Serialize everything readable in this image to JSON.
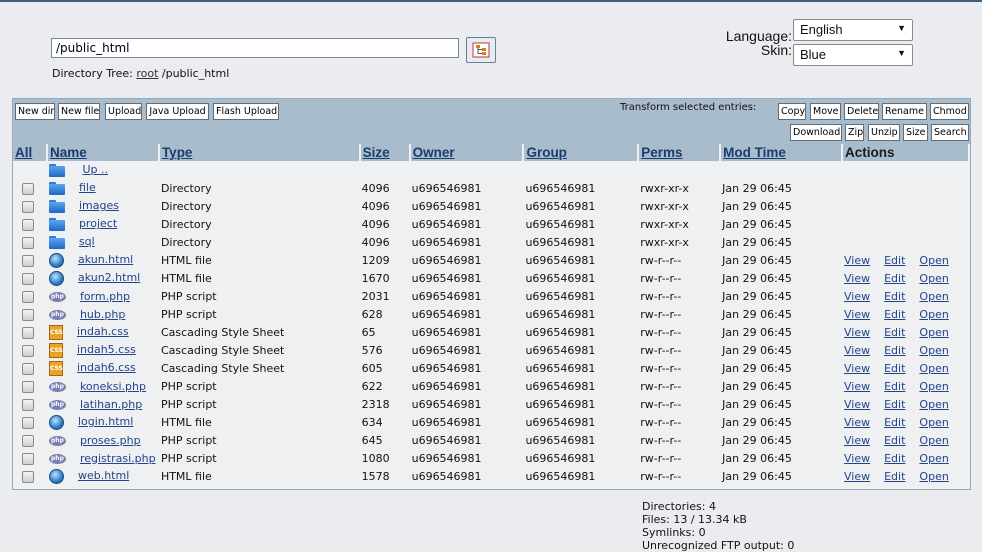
{
  "header": {
    "path_value": "/public_html",
    "directory_tree_label": "Directory Tree:",
    "directory_tree_root": "root",
    "directory_tree_path": "/public_html",
    "language_label": "Language:",
    "language_value": "English",
    "skin_label": "Skin:",
    "skin_value": "Blue"
  },
  "toolbar": {
    "buttons": [
      "New dir",
      "New file",
      "Upload",
      "Java Upload",
      "Flash Upload"
    ],
    "transform_label": "Transform selected entries:",
    "transform_row1": [
      "Copy",
      "Move",
      "Delete",
      "Rename",
      "Chmod"
    ],
    "transform_row2": [
      "Download",
      "Zip",
      "Unzip",
      "Size",
      "Search"
    ]
  },
  "table": {
    "headers": {
      "all": "All",
      "name": "Name",
      "type": "Type",
      "size": "Size",
      "owner": "Owner",
      "group": "Group",
      "perms": "Perms",
      "mod_time": "Mod Time",
      "actions": "Actions"
    },
    "up_label": "Up ..",
    "action_labels": {
      "view": "View",
      "edit": "Edit",
      "open": "Open"
    },
    "rows": [
      {
        "icon": "folder-icon",
        "name": "file",
        "type": "Directory",
        "size": "4096",
        "owner": "u696546981",
        "group": "u696546981",
        "perms": "rwxr-xr-x",
        "mod": "Jan 29 06:45"
      },
      {
        "icon": "folder-icon",
        "name": "images",
        "type": "Directory",
        "size": "4096",
        "owner": "u696546981",
        "group": "u696546981",
        "perms": "rwxr-xr-x",
        "mod": "Jan 29 06:45"
      },
      {
        "icon": "folder-icon",
        "name": "project",
        "type": "Directory",
        "size": "4096",
        "owner": "u696546981",
        "group": "u696546981",
        "perms": "rwxr-xr-x",
        "mod": "Jan 29 06:45"
      },
      {
        "icon": "folder-icon",
        "name": "sql",
        "type": "Directory",
        "size": "4096",
        "owner": "u696546981",
        "group": "u696546981",
        "perms": "rwxr-xr-x",
        "mod": "Jan 29 06:45"
      },
      {
        "icon": "html-file-icon",
        "name": "akun.html",
        "type": "HTML file",
        "size": "1209",
        "owner": "u696546981",
        "group": "u696546981",
        "perms": "rw-r--r--",
        "mod": "Jan 29 06:45"
      },
      {
        "icon": "html-file-icon",
        "name": "akun2.html",
        "type": "HTML file",
        "size": "1670",
        "owner": "u696546981",
        "group": "u696546981",
        "perms": "rw-r--r--",
        "mod": "Jan 29 06:45"
      },
      {
        "icon": "php-file-icon",
        "name": "form.php",
        "type": "PHP script",
        "size": "2031",
        "owner": "u696546981",
        "group": "u696546981",
        "perms": "rw-r--r--",
        "mod": "Jan 29 06:45"
      },
      {
        "icon": "php-file-icon",
        "name": "hub.php",
        "type": "PHP script",
        "size": "628",
        "owner": "u696546981",
        "group": "u696546981",
        "perms": "rw-r--r--",
        "mod": "Jan 29 06:45"
      },
      {
        "icon": "css-file-icon",
        "name": "indah.css",
        "type": "Cascading Style Sheet",
        "size": "65",
        "owner": "u696546981",
        "group": "u696546981",
        "perms": "rw-r--r--",
        "mod": "Jan 29 06:45"
      },
      {
        "icon": "css-file-icon",
        "name": "indah5.css",
        "type": "Cascading Style Sheet",
        "size": "576",
        "owner": "u696546981",
        "group": "u696546981",
        "perms": "rw-r--r--",
        "mod": "Jan 29 06:45"
      },
      {
        "icon": "css-file-icon",
        "name": "indah6.css",
        "type": "Cascading Style Sheet",
        "size": "605",
        "owner": "u696546981",
        "group": "u696546981",
        "perms": "rw-r--r--",
        "mod": "Jan 29 06:45"
      },
      {
        "icon": "php-file-icon",
        "name": "koneksi.php",
        "type": "PHP script",
        "size": "622",
        "owner": "u696546981",
        "group": "u696546981",
        "perms": "rw-r--r--",
        "mod": "Jan 29 06:45"
      },
      {
        "icon": "php-file-icon",
        "name": "latihan.php",
        "type": "PHP script",
        "size": "2318",
        "owner": "u696546981",
        "group": "u696546981",
        "perms": "rw-r--r--",
        "mod": "Jan 29 06:45"
      },
      {
        "icon": "html-file-icon",
        "name": "login.html",
        "type": "HTML file",
        "size": "634",
        "owner": "u696546981",
        "group": "u696546981",
        "perms": "rw-r--r--",
        "mod": "Jan 29 06:45"
      },
      {
        "icon": "php-file-icon",
        "name": "proses.php",
        "type": "PHP script",
        "size": "645",
        "owner": "u696546981",
        "group": "u696546981",
        "perms": "rw-r--r--",
        "mod": "Jan 29 06:45"
      },
      {
        "icon": "php-file-icon",
        "name": "registrasi.php",
        "type": "PHP script",
        "size": "1080",
        "owner": "u696546981",
        "group": "u696546981",
        "perms": "rw-r--r--",
        "mod": "Jan 29 06:45"
      },
      {
        "icon": "html-file-icon",
        "name": "web.html",
        "type": "HTML file",
        "size": "1578",
        "owner": "u696546981",
        "group": "u696546981",
        "perms": "rw-r--r--",
        "mod": "Jan 29 06:45"
      }
    ]
  },
  "summary": {
    "directories": "Directories: 4",
    "files": "Files: 13 / 13.34 kB",
    "symlinks": "Symlinks: 0",
    "unrecognized": "Unrecognized FTP output: 0"
  }
}
